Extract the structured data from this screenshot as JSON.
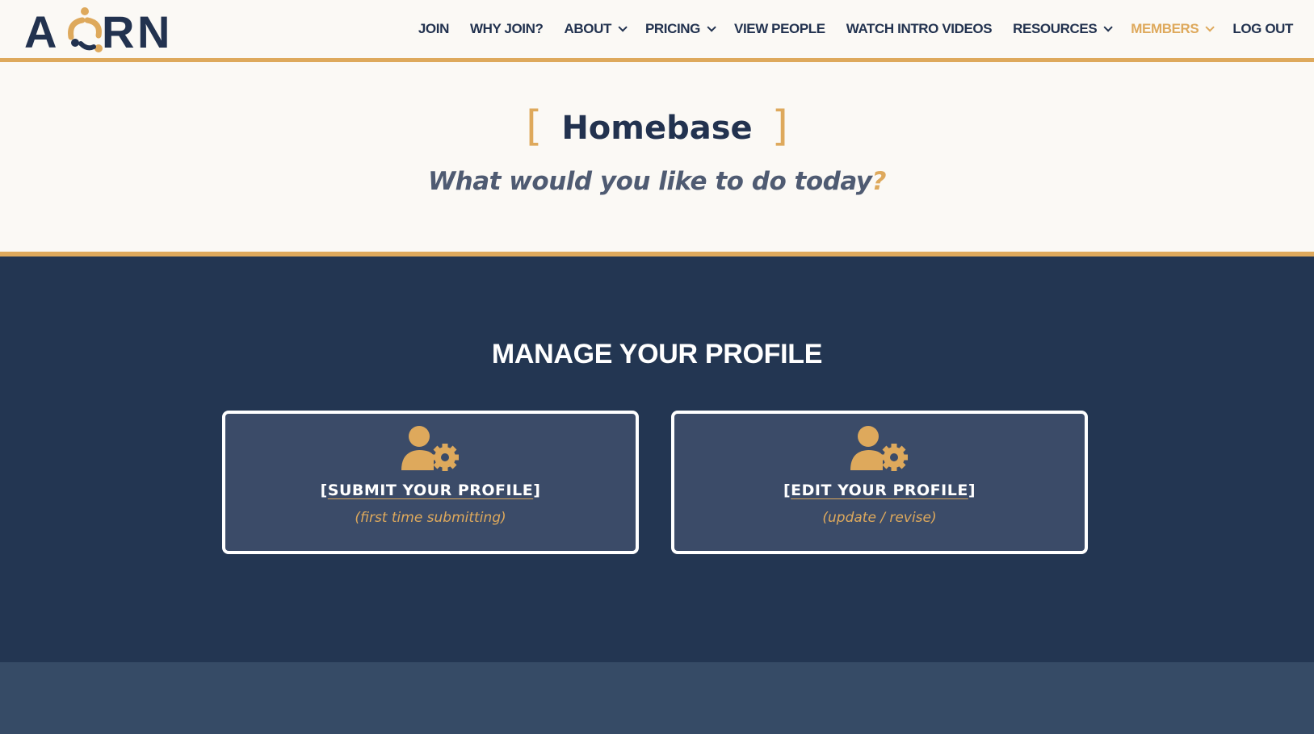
{
  "brand": {
    "logo_text": "ACORN",
    "colors": {
      "navy": "#22324f",
      "gold": "#dea95c",
      "cream": "#fbf9f5",
      "panel": "#233652",
      "card": "#3b4b68"
    }
  },
  "nav": {
    "items": [
      {
        "label": "JOIN",
        "dropdown": false,
        "active": false
      },
      {
        "label": "WHY JOIN?",
        "dropdown": false,
        "active": false
      },
      {
        "label": "ABOUT",
        "dropdown": true,
        "active": false
      },
      {
        "label": "PRICING",
        "dropdown": true,
        "active": false
      },
      {
        "label": "VIEW PEOPLE",
        "dropdown": false,
        "active": false
      },
      {
        "label": "WATCH INTRO VIDEOS",
        "dropdown": false,
        "active": false
      },
      {
        "label": "RESOURCES",
        "dropdown": true,
        "active": false
      },
      {
        "label": "MEMBERS",
        "dropdown": true,
        "active": true
      },
      {
        "label": "LOG OUT",
        "dropdown": false,
        "active": false
      }
    ]
  },
  "hero": {
    "bracket_open": "[",
    "title": "Homebase",
    "bracket_close": "]",
    "subtitle": "What would you like to do today",
    "subtitle_mark": "?"
  },
  "profile": {
    "heading": "MANAGE YOUR PROFILE",
    "cards": [
      {
        "bracket_open": "[",
        "label": "SUBMIT YOUR PROFILE",
        "bracket_close": "]",
        "sub_open": "(",
        "sub": "first time submitting",
        "sub_close": ")",
        "icon": "user-gear-icon"
      },
      {
        "bracket_open": "[",
        "label": "EDIT YOUR PROFILE",
        "bracket_close": "]",
        "sub_open": "(",
        "sub": "update / revise",
        "sub_close": ")",
        "icon": "user-gear-icon"
      }
    ]
  }
}
